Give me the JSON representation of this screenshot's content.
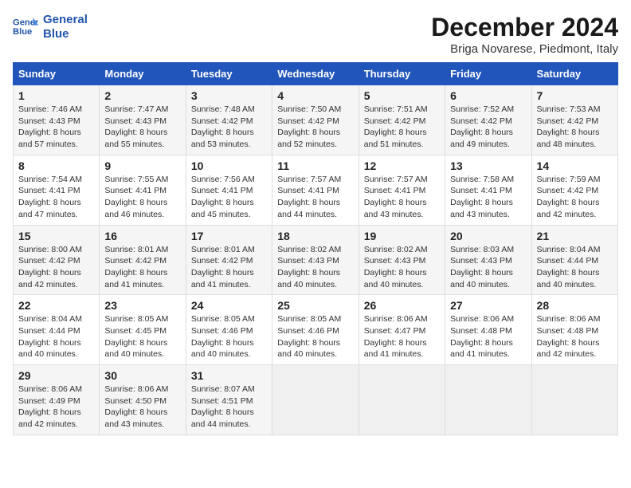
{
  "header": {
    "logo_line1": "General",
    "logo_line2": "Blue",
    "month": "December 2024",
    "location": "Briga Novarese, Piedmont, Italy"
  },
  "weekdays": [
    "Sunday",
    "Monday",
    "Tuesday",
    "Wednesday",
    "Thursday",
    "Friday",
    "Saturday"
  ],
  "weeks": [
    [
      {
        "day": "1",
        "info": "Sunrise: 7:46 AM\nSunset: 4:43 PM\nDaylight: 8 hours\nand 57 minutes."
      },
      {
        "day": "2",
        "info": "Sunrise: 7:47 AM\nSunset: 4:43 PM\nDaylight: 8 hours\nand 55 minutes."
      },
      {
        "day": "3",
        "info": "Sunrise: 7:48 AM\nSunset: 4:42 PM\nDaylight: 8 hours\nand 53 minutes."
      },
      {
        "day": "4",
        "info": "Sunrise: 7:50 AM\nSunset: 4:42 PM\nDaylight: 8 hours\nand 52 minutes."
      },
      {
        "day": "5",
        "info": "Sunrise: 7:51 AM\nSunset: 4:42 PM\nDaylight: 8 hours\nand 51 minutes."
      },
      {
        "day": "6",
        "info": "Sunrise: 7:52 AM\nSunset: 4:42 PM\nDaylight: 8 hours\nand 49 minutes."
      },
      {
        "day": "7",
        "info": "Sunrise: 7:53 AM\nSunset: 4:42 PM\nDaylight: 8 hours\nand 48 minutes."
      }
    ],
    [
      {
        "day": "8",
        "info": "Sunrise: 7:54 AM\nSunset: 4:41 PM\nDaylight: 8 hours\nand 47 minutes."
      },
      {
        "day": "9",
        "info": "Sunrise: 7:55 AM\nSunset: 4:41 PM\nDaylight: 8 hours\nand 46 minutes."
      },
      {
        "day": "10",
        "info": "Sunrise: 7:56 AM\nSunset: 4:41 PM\nDaylight: 8 hours\nand 45 minutes."
      },
      {
        "day": "11",
        "info": "Sunrise: 7:57 AM\nSunset: 4:41 PM\nDaylight: 8 hours\nand 44 minutes."
      },
      {
        "day": "12",
        "info": "Sunrise: 7:57 AM\nSunset: 4:41 PM\nDaylight: 8 hours\nand 43 minutes."
      },
      {
        "day": "13",
        "info": "Sunrise: 7:58 AM\nSunset: 4:41 PM\nDaylight: 8 hours\nand 43 minutes."
      },
      {
        "day": "14",
        "info": "Sunrise: 7:59 AM\nSunset: 4:42 PM\nDaylight: 8 hours\nand 42 minutes."
      }
    ],
    [
      {
        "day": "15",
        "info": "Sunrise: 8:00 AM\nSunset: 4:42 PM\nDaylight: 8 hours\nand 42 minutes."
      },
      {
        "day": "16",
        "info": "Sunrise: 8:01 AM\nSunset: 4:42 PM\nDaylight: 8 hours\nand 41 minutes."
      },
      {
        "day": "17",
        "info": "Sunrise: 8:01 AM\nSunset: 4:42 PM\nDaylight: 8 hours\nand 41 minutes."
      },
      {
        "day": "18",
        "info": "Sunrise: 8:02 AM\nSunset: 4:43 PM\nDaylight: 8 hours\nand 40 minutes."
      },
      {
        "day": "19",
        "info": "Sunrise: 8:02 AM\nSunset: 4:43 PM\nDaylight: 8 hours\nand 40 minutes."
      },
      {
        "day": "20",
        "info": "Sunrise: 8:03 AM\nSunset: 4:43 PM\nDaylight: 8 hours\nand 40 minutes."
      },
      {
        "day": "21",
        "info": "Sunrise: 8:04 AM\nSunset: 4:44 PM\nDaylight: 8 hours\nand 40 minutes."
      }
    ],
    [
      {
        "day": "22",
        "info": "Sunrise: 8:04 AM\nSunset: 4:44 PM\nDaylight: 8 hours\nand 40 minutes."
      },
      {
        "day": "23",
        "info": "Sunrise: 8:05 AM\nSunset: 4:45 PM\nDaylight: 8 hours\nand 40 minutes."
      },
      {
        "day": "24",
        "info": "Sunrise: 8:05 AM\nSunset: 4:46 PM\nDaylight: 8 hours\nand 40 minutes."
      },
      {
        "day": "25",
        "info": "Sunrise: 8:05 AM\nSunset: 4:46 PM\nDaylight: 8 hours\nand 40 minutes."
      },
      {
        "day": "26",
        "info": "Sunrise: 8:06 AM\nSunset: 4:47 PM\nDaylight: 8 hours\nand 41 minutes."
      },
      {
        "day": "27",
        "info": "Sunrise: 8:06 AM\nSunset: 4:48 PM\nDaylight: 8 hours\nand 41 minutes."
      },
      {
        "day": "28",
        "info": "Sunrise: 8:06 AM\nSunset: 4:48 PM\nDaylight: 8 hours\nand 42 minutes."
      }
    ],
    [
      {
        "day": "29",
        "info": "Sunrise: 8:06 AM\nSunset: 4:49 PM\nDaylight: 8 hours\nand 42 minutes."
      },
      {
        "day": "30",
        "info": "Sunrise: 8:06 AM\nSunset: 4:50 PM\nDaylight: 8 hours\nand 43 minutes."
      },
      {
        "day": "31",
        "info": "Sunrise: 8:07 AM\nSunset: 4:51 PM\nDaylight: 8 hours\nand 44 minutes."
      },
      {
        "day": "",
        "info": ""
      },
      {
        "day": "",
        "info": ""
      },
      {
        "day": "",
        "info": ""
      },
      {
        "day": "",
        "info": ""
      }
    ]
  ]
}
